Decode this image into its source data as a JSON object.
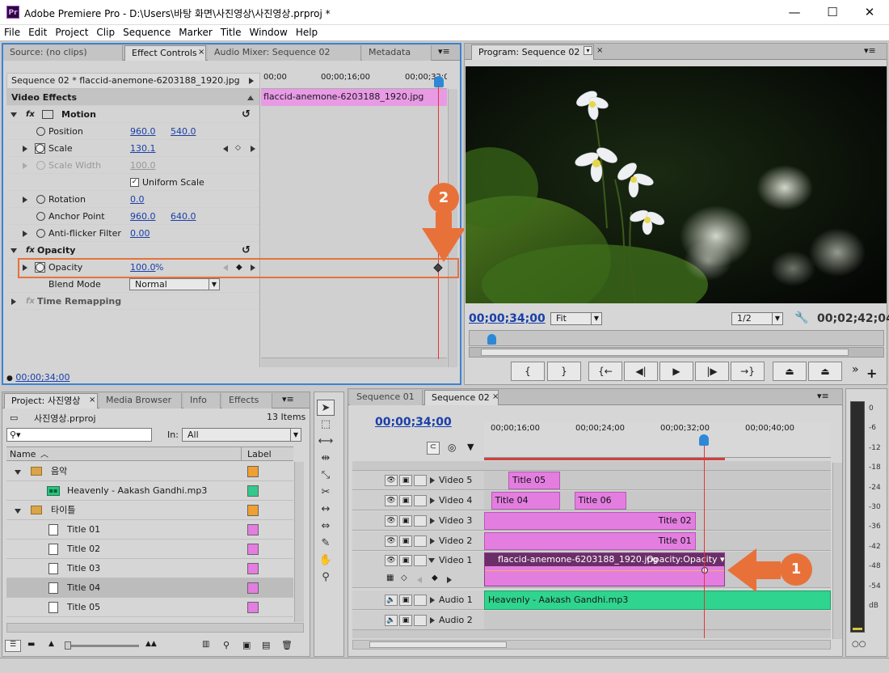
{
  "app": {
    "logo": "Pr",
    "title": "Adobe Premiere Pro - D:\\Users\\바탕 화면\\사진영상\\사진영상.prproj *"
  },
  "menu": [
    "File",
    "Edit",
    "Project",
    "Clip",
    "Sequence",
    "Marker",
    "Title",
    "Window",
    "Help"
  ],
  "source_panel": {
    "tabs": [
      "Source: (no clips)",
      "Effect Controls",
      "Audio Mixer: Sequence 02",
      "Metadata"
    ],
    "sequence_clip": "Sequence 02 * flaccid-anemone-6203188_1920.jpg",
    "ruler": [
      "00;00",
      "00;00;16;00",
      "00;00;32;0"
    ],
    "clip_name": "flaccid-anemone-6203188_1920.jpg",
    "video_effects_label": "Video Effects",
    "motion_label": "Motion",
    "position": {
      "label": "Position",
      "x": "960.0",
      "y": "540.0"
    },
    "scale": {
      "label": "Scale",
      "value": "130.1"
    },
    "scale_width": {
      "label": "Scale Width",
      "value": "100.0"
    },
    "uniform_scale": "Uniform Scale",
    "rotation": {
      "label": "Rotation",
      "value": "0.0"
    },
    "anchor_point": {
      "label": "Anchor Point",
      "x": "960.0",
      "y": "640.0"
    },
    "anti_flicker": {
      "label": "Anti-flicker Filter",
      "value": "0.00"
    },
    "opacity_group": "Opacity",
    "opacity": {
      "label": "Opacity",
      "value": "100.0",
      "unit": "%"
    },
    "blend_mode": {
      "label": "Blend Mode",
      "value": "Normal"
    },
    "time_remapping": "Time Remapping",
    "timecode": "00;00;34;00",
    "fx": "fx"
  },
  "program": {
    "tab": "Program: Sequence 02",
    "timecode": "00;00;34;00",
    "fit": "Fit",
    "resolution": "1/2",
    "duration": "00;02;42;04"
  },
  "project": {
    "tabs": [
      "Project: 사진영상",
      "Media Browser",
      "Info",
      "Effects"
    ],
    "file": "사진영상.prproj",
    "items_count": "13 Items",
    "search_placeholder": "",
    "in_label": "In:",
    "in_value": "All",
    "col_name": "Name",
    "col_label": "Label",
    "rows": [
      {
        "name": "음악",
        "color": "#f0a030",
        "indent": 0,
        "type": "folder"
      },
      {
        "name": "Heavenly - Aakash Gandhi.mp3",
        "color": "#34c98c",
        "indent": 1,
        "type": "audio"
      },
      {
        "name": "타이틀",
        "color": "#f0a030",
        "indent": 0,
        "type": "folder"
      },
      {
        "name": "Title 01",
        "color": "#e37ee0",
        "indent": 1,
        "type": "title"
      },
      {
        "name": "Title 02",
        "color": "#e37ee0",
        "indent": 1,
        "type": "title"
      },
      {
        "name": "Title 03",
        "color": "#e37ee0",
        "indent": 1,
        "type": "title"
      },
      {
        "name": "Title 04",
        "color": "#e37ee0",
        "indent": 1,
        "type": "title"
      },
      {
        "name": "Title 05",
        "color": "#e37ee0",
        "indent": 1,
        "type": "title"
      }
    ]
  },
  "timeline": {
    "tabs": [
      "Sequence 01",
      "Sequence 02"
    ],
    "timecode": "00;00;34;00",
    "ruler": [
      "00;00;16;00",
      "00;00;24;00",
      "00;00;32;00",
      "00;00;40;00"
    ],
    "tracks": [
      {
        "name": "Video 5",
        "clips": [
          {
            "label": "Title 05",
            "start": 0.07,
            "end": 0.22
          }
        ]
      },
      {
        "name": "Video 4",
        "clips": [
          {
            "label": "Title 04",
            "start": 0.02,
            "end": 0.22
          },
          {
            "label": "Title 06",
            "start": 0.26,
            "end": 0.41
          }
        ]
      },
      {
        "name": "Video 3",
        "clips": [
          {
            "label": "Title 02",
            "start": 0.0,
            "end": 0.61
          }
        ]
      },
      {
        "name": "Video 2",
        "clips": [
          {
            "label": "Title 01",
            "start": 0.0,
            "end": 0.61
          }
        ]
      }
    ],
    "video1": {
      "name": "Video 1",
      "clip": "flaccid-anemone-6203188_1920.jpg",
      "opacity_menu": "Opacity:Opacity"
    },
    "audio1": {
      "name": "Audio 1",
      "clip": "Heavenly - Aakash Gandhi.mp3"
    },
    "audio2": {
      "name": "Audio 2"
    }
  },
  "meter": {
    "labels": [
      "0",
      "-6",
      "-12",
      "-18",
      "-24",
      "-30",
      "-36",
      "-42",
      "-48",
      "-54",
      "dB"
    ]
  },
  "callouts": {
    "one": "1",
    "two": "2"
  },
  "colors": {
    "accent_orange": "#e8713a",
    "playhead": "#e53535",
    "clip_pink": "#e37ee0",
    "audio_green": "#2fd48e",
    "timecode_blue": "#1a3fa8"
  }
}
